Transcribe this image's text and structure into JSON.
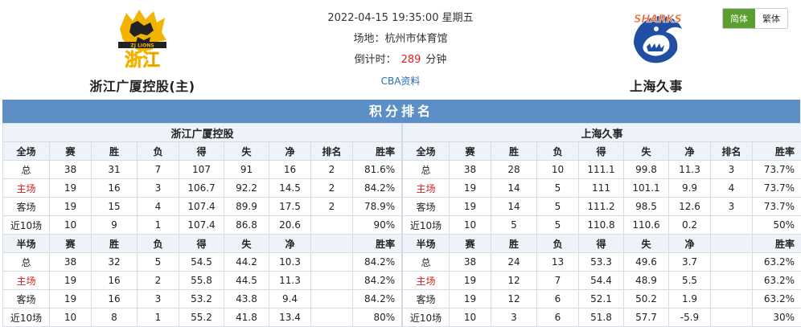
{
  "match": {
    "datetime": "2022-04-15 19:35:00 星期五",
    "venue": "场地：杭州市体育馆",
    "countdown_label": "倒计时：",
    "countdown_value": "289",
    "countdown_unit": "分钟",
    "cba_link": "CBA资料"
  },
  "home_team": {
    "name": "浙江广厦控股(主)",
    "short_name": "浙江广厦控股",
    "logo_text": "浙江",
    "logo_sub": "ZJ LIONS"
  },
  "away_team": {
    "name": "上海久事",
    "short_name": "上海久事",
    "logo_text": "SHARKS"
  },
  "lang": {
    "simplified": "简体",
    "traditional": "繁体"
  },
  "colors": {
    "banner": "#5b8fc5",
    "home_red": "#d02020",
    "lang_active": "#5a9e2f"
  },
  "standings": {
    "title": "积分排名",
    "full_headers": [
      "全场",
      "赛",
      "胜",
      "负",
      "得",
      "失",
      "净",
      "排名",
      "胜率"
    ],
    "half_headers": [
      "半场",
      "赛",
      "胜",
      "负",
      "得",
      "失",
      "净",
      "",
      "胜率"
    ],
    "home_full": [
      [
        "总",
        "38",
        "31",
        "7",
        "107",
        "91",
        "16",
        "2",
        "81.6%"
      ],
      [
        "主场",
        "19",
        "16",
        "3",
        "106.7",
        "92.2",
        "14.5",
        "2",
        "84.2%"
      ],
      [
        "客场",
        "19",
        "15",
        "4",
        "107.4",
        "89.9",
        "17.5",
        "2",
        "78.9%"
      ],
      [
        "近10场",
        "10",
        "9",
        "1",
        "107.4",
        "86.8",
        "20.6",
        "",
        "90%"
      ]
    ],
    "home_half": [
      [
        "总",
        "38",
        "32",
        "5",
        "54.5",
        "44.2",
        "10.3",
        "",
        "84.2%"
      ],
      [
        "主场",
        "19",
        "16",
        "2",
        "55.8",
        "44.5",
        "11.3",
        "",
        "84.2%"
      ],
      [
        "客场",
        "19",
        "16",
        "3",
        "53.2",
        "43.8",
        "9.4",
        "",
        "84.2%"
      ],
      [
        "近10场",
        "10",
        "8",
        "1",
        "55.2",
        "41.8",
        "13.4",
        "",
        "80%"
      ]
    ],
    "away_full": [
      [
        "总",
        "38",
        "28",
        "10",
        "111.1",
        "99.8",
        "11.3",
        "3",
        "73.7%"
      ],
      [
        "主场",
        "19",
        "14",
        "5",
        "111",
        "101.1",
        "9.9",
        "4",
        "73.7%"
      ],
      [
        "客场",
        "19",
        "14",
        "5",
        "111.2",
        "98.5",
        "12.6",
        "3",
        "73.7%"
      ],
      [
        "近10场",
        "10",
        "5",
        "5",
        "110.8",
        "110.6",
        "0.2",
        "",
        "50%"
      ]
    ],
    "away_half": [
      [
        "总",
        "38",
        "24",
        "13",
        "53.3",
        "49.6",
        "3.7",
        "",
        "63.2%"
      ],
      [
        "主场",
        "19",
        "12",
        "7",
        "54.4",
        "48.9",
        "5.5",
        "",
        "63.2%"
      ],
      [
        "客场",
        "19",
        "12",
        "6",
        "52.1",
        "50.2",
        "1.9",
        "",
        "63.2%"
      ],
      [
        "近10场",
        "10",
        "3",
        "6",
        "51.8",
        "57.7",
        "-5.9",
        "",
        "30%"
      ]
    ]
  }
}
